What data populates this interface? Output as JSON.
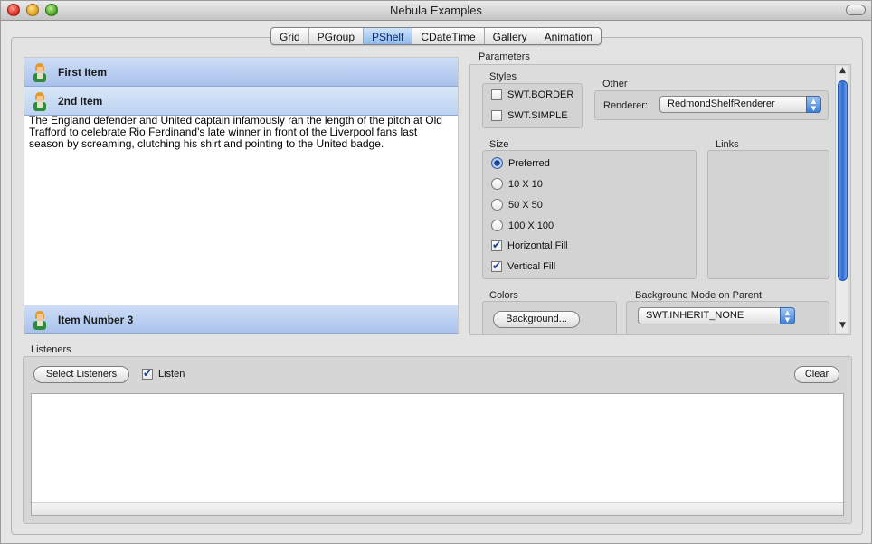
{
  "window": {
    "title": "Nebula Examples"
  },
  "tabs": [
    {
      "label": "Grid"
    },
    {
      "label": "PGroup"
    },
    {
      "label": "PShelf",
      "active": true
    },
    {
      "label": "CDateTime"
    },
    {
      "label": "Gallery"
    },
    {
      "label": "Animation"
    }
  ],
  "shelf": {
    "items": [
      {
        "label": "First Item",
        "icon": "person-icon"
      },
      {
        "label": "2nd Item",
        "icon": "person-icon",
        "expanded": true
      },
      {
        "label": "Item Number 3",
        "icon": "person-icon"
      }
    ],
    "body_text": "The England defender and United captain infamously ran the length of the pitch at Old Trafford to celebrate Rio Ferdinand's late winner in front of the Liverpool fans last season by screaming, clutching his shirt and pointing to the United badge."
  },
  "parameters": {
    "title": "Parameters",
    "styles": {
      "label": "Styles",
      "options": [
        {
          "label": "SWT.BORDER",
          "checked": false
        },
        {
          "label": "SWT.SIMPLE",
          "checked": false
        }
      ]
    },
    "other": {
      "label": "Other",
      "renderer_label": "Renderer:",
      "renderer_value": "RedmondShelfRenderer"
    },
    "size": {
      "label": "Size",
      "options": [
        {
          "label": "Preferred",
          "selected": true
        },
        {
          "label": "10 X 10",
          "selected": false
        },
        {
          "label": "50 X 50",
          "selected": false
        },
        {
          "label": "100 X 100",
          "selected": false
        }
      ],
      "fills": [
        {
          "label": "Horizontal Fill",
          "checked": true
        },
        {
          "label": "Vertical Fill",
          "checked": true
        }
      ]
    },
    "links": {
      "label": "Links"
    },
    "colors": {
      "label": "Colors",
      "background_button": "Background..."
    },
    "background_mode": {
      "label": "Background Mode on Parent",
      "value": "SWT.INHERIT_NONE"
    }
  },
  "listeners": {
    "label": "Listeners",
    "select_button": "Select Listeners",
    "listen_label": "Listen",
    "listen_checked": true,
    "clear_button": "Clear"
  },
  "colors": {
    "accent": "#3e7fd6",
    "header_blue": "#a9c2ec",
    "window_bg": "#e6e6e6"
  }
}
